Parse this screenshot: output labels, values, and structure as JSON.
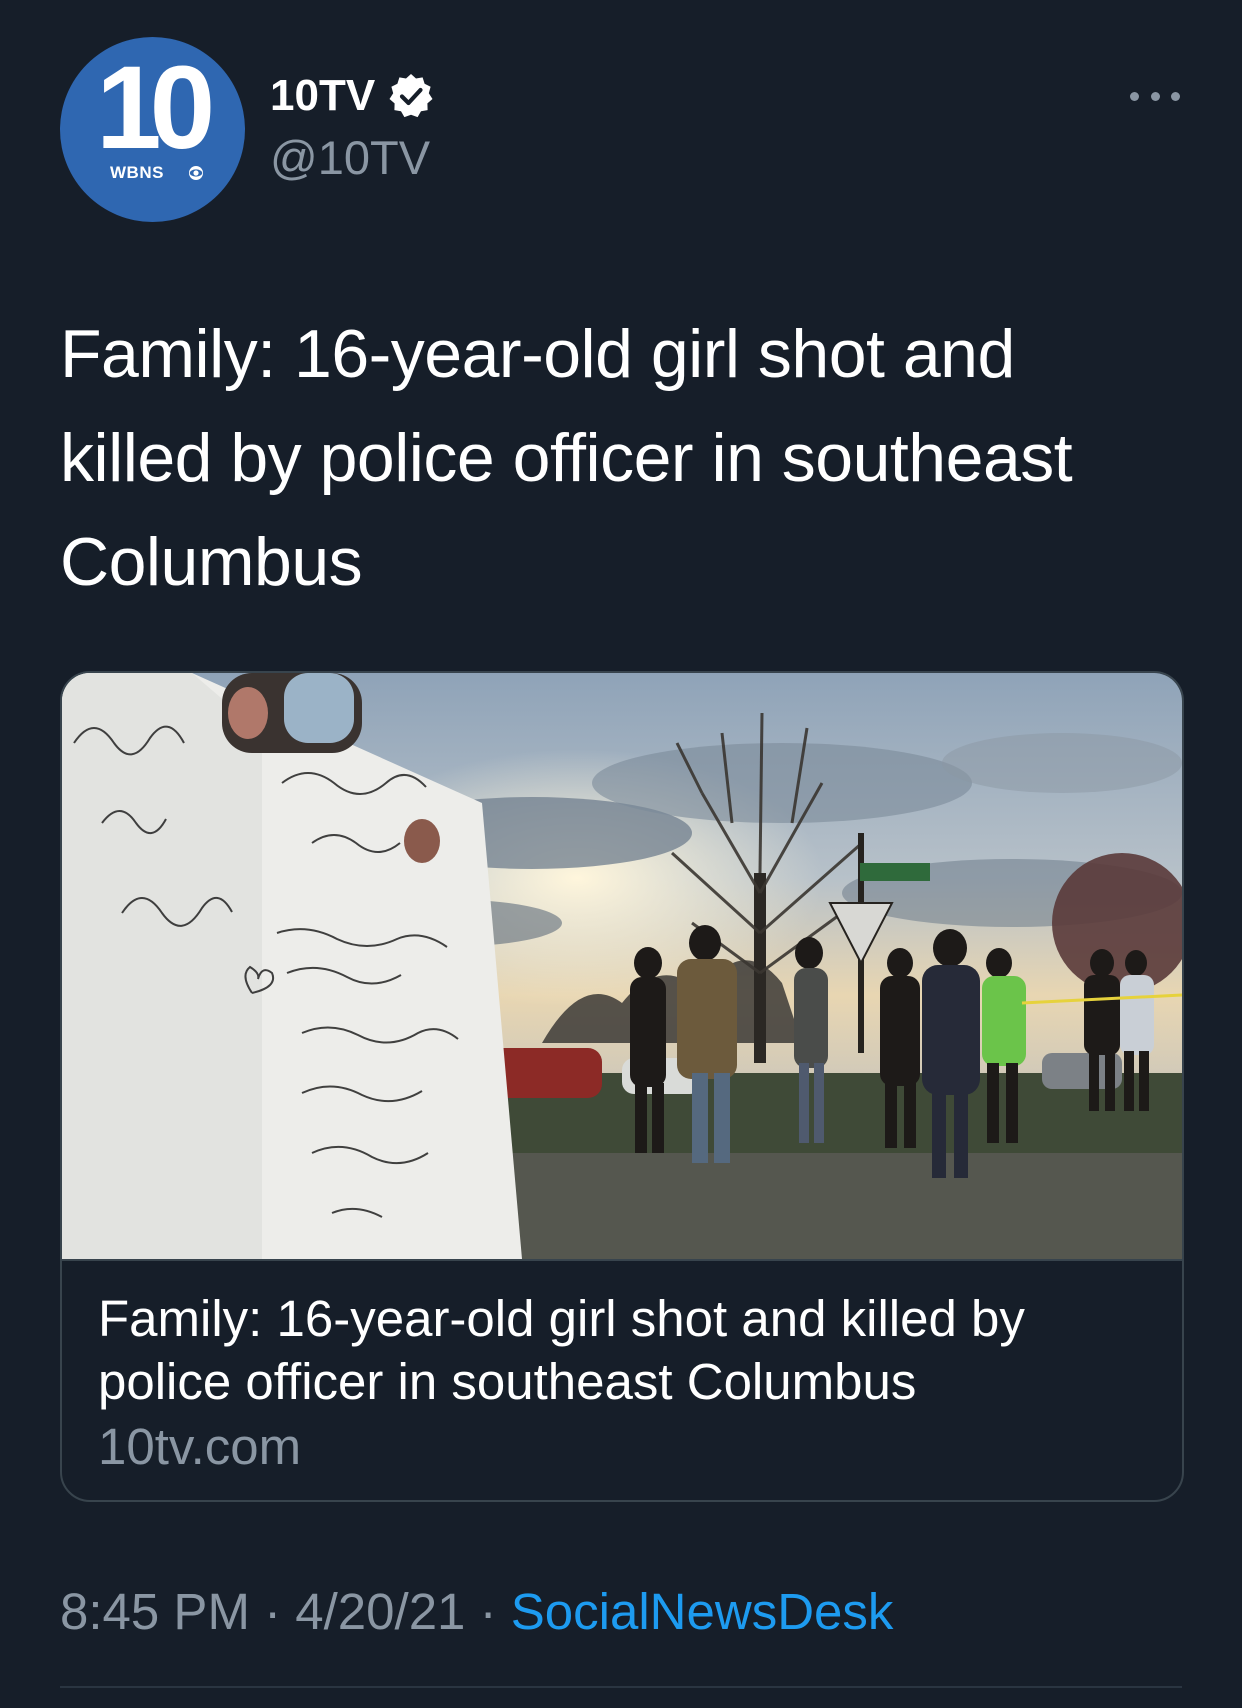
{
  "author": {
    "display_name": "10TV",
    "handle": "@10TV",
    "avatar": {
      "logo_number": "10",
      "call_sign": "WBNS",
      "brand_color": "#2f67b1"
    },
    "verified_icon": "verified-badge-icon"
  },
  "more_options_icon": "more-horizontal-icon",
  "tweet": {
    "text": "Family: 16-year-old girl shot and killed by police officer in southeast Columbus"
  },
  "link_card": {
    "image_icon": "news-photo",
    "title": "Family: 16-year-old girl shot and killed by police officer in southeast Columbus",
    "domain": "10tv.com"
  },
  "meta": {
    "time": "8:45 PM",
    "separator": "·",
    "date": "4/20/21",
    "source": "SocialNewsDesk"
  },
  "colors": {
    "background": "#161e29",
    "text_primary": "#ffffff",
    "text_secondary": "#8a96a3",
    "link": "#1d9bf0",
    "border": "#38444d"
  }
}
